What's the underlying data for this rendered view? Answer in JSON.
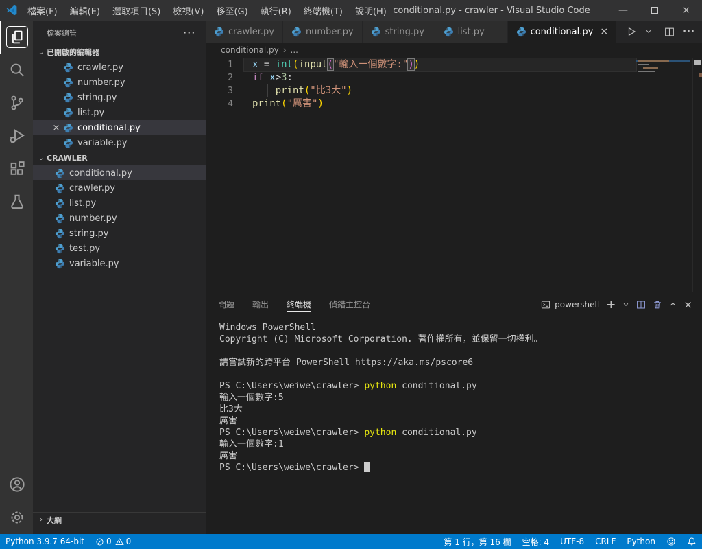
{
  "colors": {
    "accent": "#007acc",
    "titlebar_bg": "#323233",
    "activitybar_bg": "#333333",
    "sidebar_bg": "#252526",
    "editor_bg": "#1e1e1e",
    "statusbar_bg": "#007acc",
    "selection_row": "#37373d",
    "terminal_command_yellow": "#e5e510",
    "string_orange": "#ce9178",
    "keyword_purple": "#c586c0",
    "function_yellow": "#dcdcaa",
    "type_teal": "#4ec9b0",
    "variable_blue": "#9cdcfe",
    "number_green": "#b5cea8"
  },
  "title_bar": {
    "title": "conditional.py - crawler - Visual Studio Code",
    "menus": [
      {
        "label": "檔案(F)"
      },
      {
        "label": "編輯(E)"
      },
      {
        "label": "選取項目(S)"
      },
      {
        "label": "檢視(V)"
      },
      {
        "label": "移至(G)"
      },
      {
        "label": "執行(R)"
      },
      {
        "label": "終端機(T)"
      },
      {
        "label": "說明(H)"
      }
    ],
    "window_controls": {
      "minimize_icon": "—",
      "maximize_icon": "maximize-square",
      "close_icon": "×"
    }
  },
  "activity_bar": {
    "items": [
      {
        "icon": "files-icon",
        "active": true
      },
      {
        "icon": "search-icon"
      },
      {
        "icon": "source-control-icon"
      },
      {
        "icon": "run-debug-icon"
      },
      {
        "icon": "extensions-icon"
      },
      {
        "icon": "testing-icon"
      }
    ],
    "bottom_items": [
      {
        "icon": "account-icon"
      },
      {
        "icon": "settings-gear-icon"
      }
    ]
  },
  "sidebar": {
    "title": "檔案總管",
    "more_icon": "···",
    "open_editors": {
      "label": "已開啟的編輯器",
      "items": [
        {
          "label": "crawler.py"
        },
        {
          "label": "number.py"
        },
        {
          "label": "string.py"
        },
        {
          "label": "list.py"
        },
        {
          "label": "conditional.py",
          "active": true,
          "close_icon": "×"
        },
        {
          "label": "variable.py"
        }
      ]
    },
    "folder": {
      "label": "CRAWLER",
      "items": [
        {
          "label": "conditional.py",
          "selected": true
        },
        {
          "label": "crawler.py"
        },
        {
          "label": "list.py"
        },
        {
          "label": "number.py"
        },
        {
          "label": "string.py"
        },
        {
          "label": "test.py"
        },
        {
          "label": "variable.py"
        }
      ]
    },
    "outline": {
      "label": "大綱"
    }
  },
  "editor": {
    "tabs": [
      {
        "label": "crawler.py"
      },
      {
        "label": "number.py"
      },
      {
        "label": "string.py"
      },
      {
        "label": "list.py"
      },
      {
        "label": "conditional.py",
        "active": true,
        "close_icon": "×"
      }
    ],
    "breadcrumb": {
      "file": "conditional.py",
      "separator": "›",
      "more": "..."
    },
    "code_lines": [
      {
        "num": "1",
        "current": true,
        "tokens": [
          {
            "t": "x",
            "c": "var"
          },
          {
            "t": " = ",
            "c": "plain"
          },
          {
            "t": "int",
            "c": "type"
          },
          {
            "t": "(",
            "c": "br1"
          },
          {
            "t": "input",
            "c": "func"
          },
          {
            "t": "(",
            "c": "br2",
            "m": true
          },
          {
            "t": "\"輸入一個數字:\"",
            "c": "str"
          },
          {
            "t": ")",
            "c": "br2",
            "m": true
          },
          {
            "t": ")",
            "c": "br1"
          }
        ]
      },
      {
        "num": "2",
        "tokens": [
          {
            "t": "if",
            "c": "kw"
          },
          {
            "t": " ",
            "c": "plain"
          },
          {
            "t": "x",
            "c": "var"
          },
          {
            "t": ">",
            "c": "plain"
          },
          {
            "t": "3",
            "c": "num"
          },
          {
            "t": ":",
            "c": "plain"
          }
        ]
      },
      {
        "num": "3",
        "tokens": [
          {
            "t": "    ",
            "c": "ws"
          },
          {
            "t": "print",
            "c": "func"
          },
          {
            "t": "(",
            "c": "br1"
          },
          {
            "t": "\"比3大\"",
            "c": "str"
          },
          {
            "t": ")",
            "c": "br1"
          }
        ]
      },
      {
        "num": "4",
        "tokens": [
          {
            "t": "print",
            "c": "func"
          },
          {
            "t": "(",
            "c": "br1"
          },
          {
            "t": "\"厲害\"",
            "c": "str"
          },
          {
            "t": ")",
            "c": "br1"
          }
        ]
      }
    ]
  },
  "panel": {
    "tabs": [
      {
        "label": "問題"
      },
      {
        "label": "輸出"
      },
      {
        "label": "終端機",
        "active": true
      },
      {
        "label": "偵錯主控台"
      }
    ],
    "shell_label": "powershell",
    "terminal_lines": [
      [
        {
          "t": "Windows PowerShell"
        }
      ],
      [
        {
          "t": "Copyright (C) Microsoft Corporation. 著作權所有，並保留一切權利。"
        }
      ],
      [],
      [
        {
          "t": "請嘗試新的跨平台 PowerShell https://aka.ms/pscore6"
        }
      ],
      [],
      [
        {
          "t": "PS C:\\Users\\weiwe\\crawler> "
        },
        {
          "t": "python",
          "c": "cmd"
        },
        {
          "t": " conditional.py"
        }
      ],
      [
        {
          "t": "輸入一個數字:5"
        }
      ],
      [
        {
          "t": "比3大"
        }
      ],
      [
        {
          "t": "厲害"
        }
      ],
      [
        {
          "t": "PS C:\\Users\\weiwe\\crawler> "
        },
        {
          "t": "python",
          "c": "cmd"
        },
        {
          "t": " conditional.py"
        }
      ],
      [
        {
          "t": "輸入一個數字:1"
        }
      ],
      [
        {
          "t": "厲害"
        }
      ],
      [
        {
          "t": "PS C:\\Users\\weiwe\\crawler> "
        },
        {
          "cursor": true
        }
      ]
    ]
  },
  "status_bar": {
    "python_version": "Python 3.9.7 64-bit",
    "error_count": "0",
    "warning_count": "0",
    "cursor_position": "第 1 行，第 16 欄",
    "indentation": "空格: 4",
    "encoding": "UTF-8",
    "eol": "CRLF",
    "language": "Python"
  }
}
